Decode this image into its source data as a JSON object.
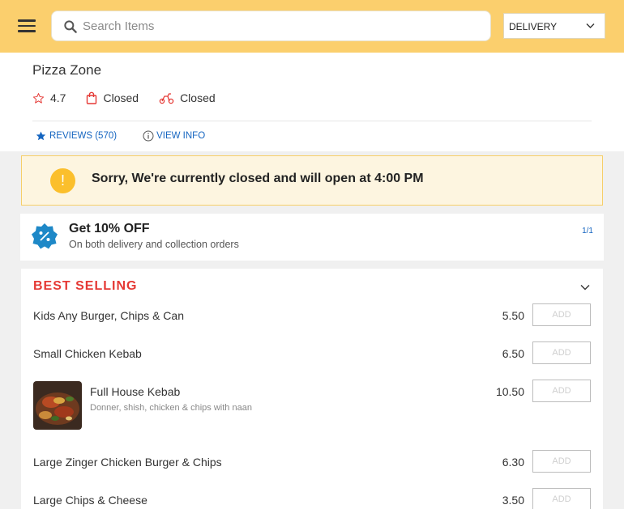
{
  "search": {
    "placeholder": "Search Items"
  },
  "order_mode": {
    "selected": "DELIVERY"
  },
  "store": {
    "name": "Pizza Zone",
    "rating": "4.7",
    "pickup_status": "Closed",
    "delivery_status": "Closed",
    "reviews_label": "REVIEWS (570)",
    "info_label": "VIEW INFO"
  },
  "notice": {
    "text": "Sorry, We're currently closed and will open at 4:00 PM"
  },
  "promo": {
    "title": "Get 10% OFF",
    "subtitle": "On both delivery and collection orders",
    "counter": "1/1"
  },
  "category": {
    "title": "BEST SELLING",
    "items": [
      {
        "name": "Kids Any Burger, Chips & Can",
        "price": "5.50",
        "add_label": "ADD"
      },
      {
        "name": "Small Chicken Kebab",
        "price": "6.50",
        "add_label": "ADD"
      },
      {
        "name": "Full House Kebab",
        "description": "Donner, shish, chicken & chips with naan",
        "price": "10.50",
        "add_label": "ADD"
      },
      {
        "name": "Large Zinger Chicken Burger & Chips",
        "price": "6.30",
        "add_label": "ADD"
      },
      {
        "name": "Large Chips & Cheese",
        "price": "3.50",
        "add_label": "ADD"
      }
    ]
  },
  "colors": {
    "header_bg": "#fbcf6d",
    "accent_blue": "#1565c0",
    "category_red": "#e53935",
    "notice_bg": "#fdf5e0",
    "warning_icon": "#fbbf2c",
    "promo_badge": "#1e88c7"
  },
  "icons": [
    "menu-icon",
    "search-icon",
    "chevron-down-icon",
    "star-outline-icon",
    "shopping-bag-icon",
    "scooter-icon",
    "star-icon",
    "info-icon",
    "exclamation-icon",
    "percent-badge-icon"
  ]
}
